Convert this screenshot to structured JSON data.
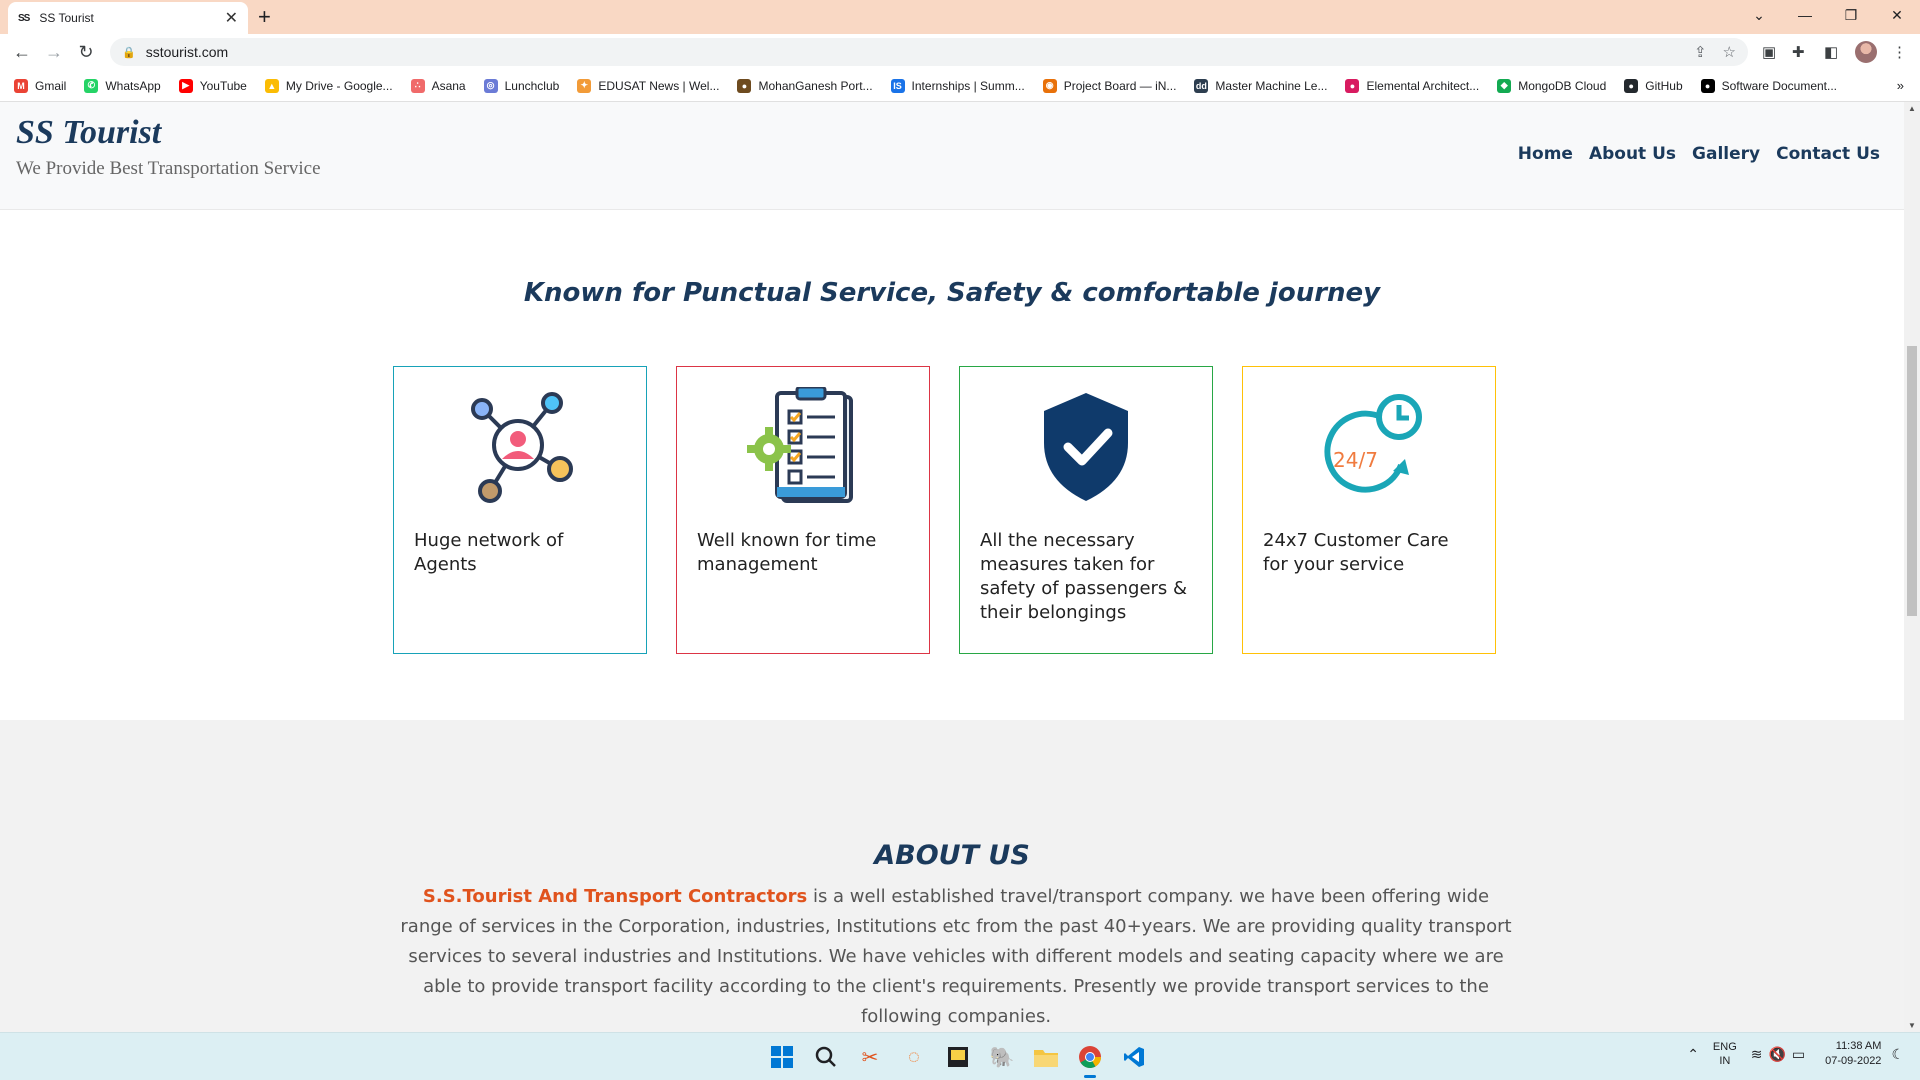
{
  "browser": {
    "tab": {
      "title": "SS Tourist",
      "favicon": "SS"
    },
    "url": "sstourist.com",
    "bookmarks": [
      {
        "label": "Gmail",
        "color": "#ea4335",
        "glyph": "M"
      },
      {
        "label": "WhatsApp",
        "color": "#25d366",
        "glyph": "✆"
      },
      {
        "label": "YouTube",
        "color": "#ff0000",
        "glyph": "▶"
      },
      {
        "label": "My Drive - Google...",
        "color": "#fbbc04",
        "glyph": "▲"
      },
      {
        "label": "Asana",
        "color": "#f06a6a",
        "glyph": "∴"
      },
      {
        "label": "Lunchclub",
        "color": "#6b7bd6",
        "glyph": "◎"
      },
      {
        "label": "EDUSAT News | Wel...",
        "color": "#f29b38",
        "glyph": "✦"
      },
      {
        "label": "MohanGanesh Port...",
        "color": "#6e4b1f",
        "glyph": "●"
      },
      {
        "label": "Internships | Summ...",
        "color": "#1a73e8",
        "glyph": "IS"
      },
      {
        "label": "Project Board — iN...",
        "color": "#e8710a",
        "glyph": "◉"
      },
      {
        "label": "Master Machine Le...",
        "color": "#2d3e50",
        "glyph": "dd"
      },
      {
        "label": "Elemental Architect...",
        "color": "#d81b60",
        "glyph": "●"
      },
      {
        "label": "MongoDB Cloud",
        "color": "#13aa52",
        "glyph": "◆"
      },
      {
        "label": "GitHub",
        "color": "#24292e",
        "glyph": "●"
      },
      {
        "label": "Software Document...",
        "color": "#000000",
        "glyph": "●"
      }
    ],
    "bookmarks_more": "»"
  },
  "site": {
    "brand": "SS Tourist",
    "tagline": "We Provide Best Transportation Service",
    "nav": [
      "Home",
      "About Us",
      "Gallery",
      "Contact Us"
    ]
  },
  "features": {
    "heading": "Known for Punctual Service, Safety & comfortable journey",
    "cards": [
      {
        "text": "Huge network of Agents",
        "border": "#17a2b8",
        "icon": "network-icon"
      },
      {
        "text": "Well known for time management",
        "border": "#dc3545",
        "icon": "checklist-gear-icon"
      },
      {
        "text": "All the necessary measures taken for safety of passengers & their belongings",
        "border": "#28a745",
        "icon": "shield-check-icon"
      },
      {
        "text": "24x7 Customer Care for your service",
        "border": "#ffc107",
        "icon": "clock-24-7-icon"
      }
    ]
  },
  "about": {
    "title": "ABOUT US",
    "company": "S.S.Tourist And Transport Contractors",
    "body": " is a well established travel/transport company. we have been offering wide range of services in the Corporation, industries, Institutions etc from the past 40+years. We are providing quality transport services to several industries and Institutions. We have vehicles with different models and seating capacity where we are able to provide transport facility according to the client's requirements. Presently we provide transport services to the following companies."
  },
  "taskbar": {
    "lang": "ENG",
    "region": "IN",
    "time": "11:38 AM",
    "date": "07-09-2022"
  }
}
